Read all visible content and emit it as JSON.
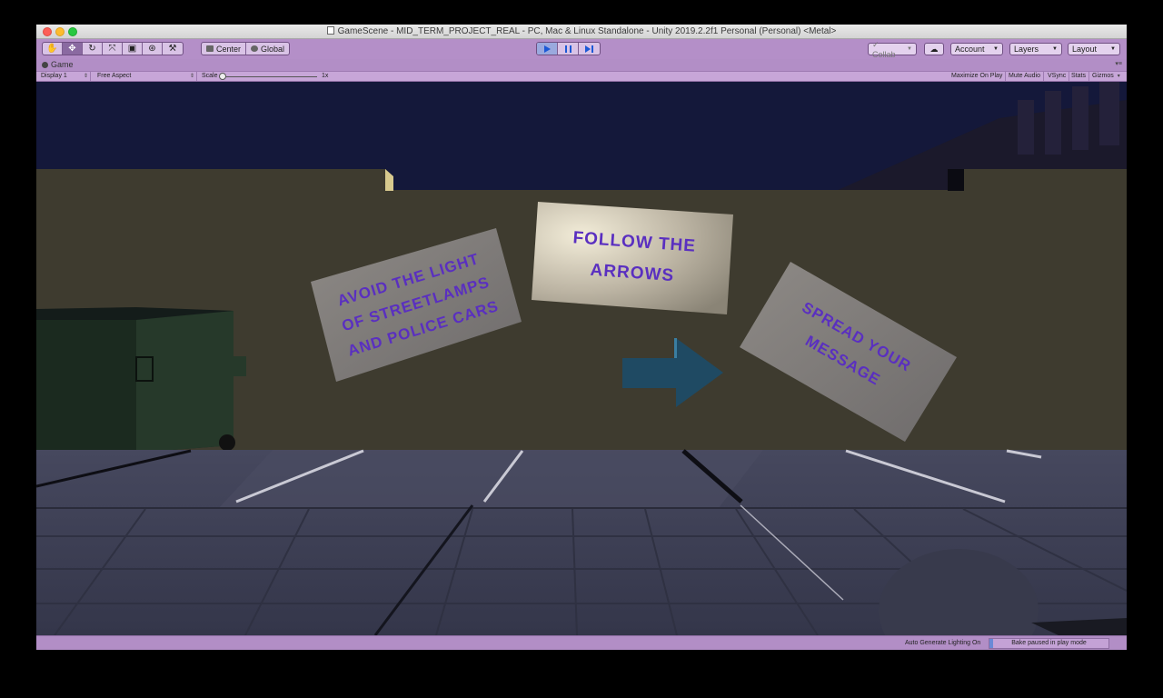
{
  "window": {
    "title": "GameScene - MID_TERM_PROJECT_REAL - PC, Mac & Linux Standalone - Unity 2019.2.2f1 Personal (Personal) <Metal>"
  },
  "toolbar": {
    "tools": [
      {
        "icon": "hand-tool-icon",
        "glyph": "✋"
      },
      {
        "icon": "move-tool-icon",
        "glyph": "✥"
      },
      {
        "icon": "rotate-tool-icon",
        "glyph": "↻"
      },
      {
        "icon": "scale-tool-icon",
        "glyph": "⤧"
      },
      {
        "icon": "rect-tool-icon",
        "glyph": "▣"
      },
      {
        "icon": "transform-tool-icon",
        "glyph": "⊛"
      },
      {
        "icon": "custom-tool-icon",
        "glyph": "⚒"
      }
    ],
    "pivot_label": "Center",
    "rotation_label": "Global",
    "collab_label": "Collab",
    "account_label": "Account",
    "layers_label": "Layers",
    "layout_label": "Layout"
  },
  "game_view": {
    "tab_label": "Game",
    "display_label": "Display 1",
    "aspect_label": "Free Aspect",
    "scale_label": "Scale",
    "scale_value": "1x",
    "maximize_label": "Maximize On Play",
    "mute_label": "Mute Audio",
    "vsync_label": "VSync",
    "stats_label": "Stats",
    "gizmos_label": "Gizmos"
  },
  "scene": {
    "sign_left": [
      "AVOID THE LIGHT",
      "OF STREETLAMPS",
      "AND POLICE CARS"
    ],
    "sign_center": [
      "FOLLOW THE",
      "ARROWS"
    ],
    "sign_right": [
      "SPREAD YOUR",
      "MESSAGE"
    ],
    "colors": {
      "sky": "#14183a",
      "wall": "#3e3b2f",
      "ground": "#3b3d52",
      "sign_text": "#5a2fc0",
      "arrow": "#1f4a63"
    }
  },
  "status": {
    "lighting_label": "Auto Generate Lighting On",
    "bake_label": "Bake paused in play mode",
    "bake_progress": 0.03
  }
}
